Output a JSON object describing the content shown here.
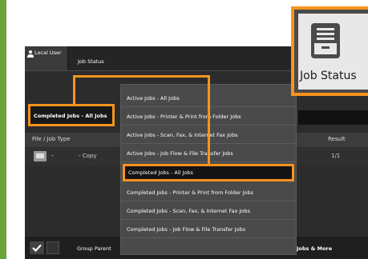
{
  "header": {
    "user_label": "Local User",
    "tab_label": "Job Status"
  },
  "selector": {
    "current": "Completed Jobs - All Jobs"
  },
  "table": {
    "columns": [
      "File / Job Type",
      "Result"
    ],
    "rows": [
      {
        "name": "-",
        "type": "- Copy",
        "result": "1/1"
      }
    ]
  },
  "dropdown": {
    "items": [
      "Active Jobs - All Jobs",
      "Active Jobs - Printer & Print from Folder Jobs",
      "Active Jobs - Scan, Fax, & Internet Fax Jobs",
      "Active Jobs - Job Flow & File Transfer Jobs",
      "Completed Jobs - All Jobs",
      "Completed Jobs - Printer & Print from Folder Jobs",
      "Completed Jobs - Scan, Fax, & Internet Fax Jobs",
      "Completed Jobs - Job Flow & File Transfer Jobs"
    ],
    "selected_index": 4
  },
  "bottom": {
    "group_parent": "Group Parent",
    "jobs_more": "Jobs & More"
  },
  "job_status_button": {
    "label": "Job Status",
    "icon": "paper-tray-icon"
  },
  "colors": {
    "highlight": "#f7941d",
    "accent_bar": "#6aa33a"
  }
}
